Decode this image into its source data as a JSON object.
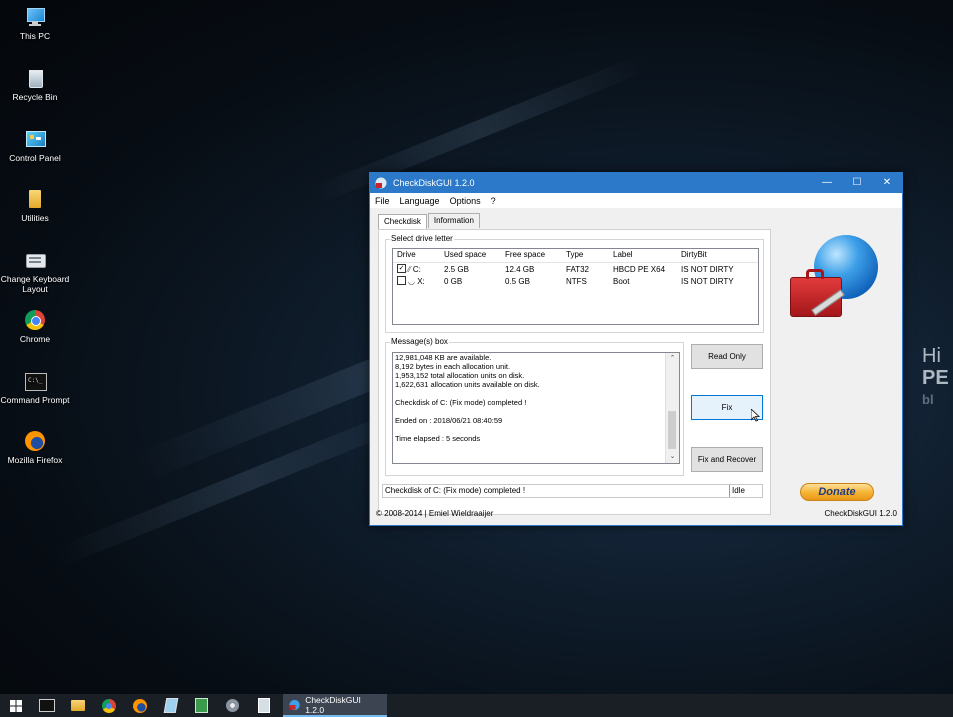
{
  "desktop": {
    "icons": [
      {
        "label": "This PC",
        "icon": "computer-icon"
      },
      {
        "label": "Recycle Bin",
        "icon": "recycle-bin-icon"
      },
      {
        "label": "Control Panel",
        "icon": "control-panel-icon"
      },
      {
        "label": "Utilities",
        "icon": "folder-icon"
      },
      {
        "label": "Change Keyboard Layout",
        "icon": "keyboard-icon"
      },
      {
        "label": "Chrome",
        "icon": "chrome-icon"
      },
      {
        "label": "Command Prompt",
        "icon": "command-prompt-icon"
      },
      {
        "label": "Mozilla Firefox",
        "icon": "firefox-icon"
      }
    ],
    "wallpaper_text": [
      "Hi",
      "PE",
      "bl"
    ]
  },
  "window": {
    "title": "CheckDiskGUI 1.2.0",
    "controls": {
      "minimize": "—",
      "maximize": "☐",
      "close": "✕"
    },
    "menu": [
      "File",
      "Language",
      "Options",
      "?"
    ],
    "tabs": [
      "Checkdisk",
      "Information"
    ],
    "drive_group": {
      "label": "Select drive letter",
      "columns": [
        "Drive",
        "Used space",
        "Free space",
        "Type",
        "Label",
        "DirtyBit"
      ],
      "rows": [
        {
          "checked": true,
          "drive": "C:",
          "used": "2.5 GB",
          "free": "12.4 GB",
          "type": "FAT32",
          "label": "HBCD PE X64",
          "dirty": "IS NOT DIRTY"
        },
        {
          "checked": false,
          "drive": "X:",
          "used": "0 GB",
          "free": "0.5 GB",
          "type": "NTFS",
          "label": "Boot",
          "dirty": "IS NOT DIRTY"
        }
      ]
    },
    "message_group": {
      "label": "Message(s) box",
      "lines": [
        "12,981,048 KB are available.",
        "  8,192 bytes in each allocation unit.",
        "  1,953,152 total allocation units on disk.",
        "  1,622,631 allocation units available on disk.",
        "",
        "Checkdisk of C: (Fix mode) completed !",
        "",
        "Ended on : 2018/06/21 08:40:59",
        "",
        "Time elapsed : 5 seconds"
      ]
    },
    "buttons": {
      "read_only": "Read Only",
      "fix": "Fix",
      "fix_recover": "Fix and Recover",
      "donate": "Donate"
    },
    "status": {
      "message": "Checkdisk of C: (Fix mode) completed !",
      "state": "Idle"
    },
    "footer": {
      "copyright": "© 2008-2014 | Emiel Wieldraaijer",
      "version": "CheckDiskGUI 1.2.0"
    }
  },
  "taskbar": {
    "items": [
      "start-icon",
      "command-prompt-icon",
      "file-explorer-icon",
      "chrome-icon",
      "firefox-icon",
      "notepad-icon",
      "spreadsheet-icon",
      "disk-tool-icon",
      "document-icon"
    ],
    "active_app": "CheckDiskGUI 1.2.0"
  },
  "colors": {
    "titlebar": "#2b79c8",
    "focus": "#0078d7",
    "taskbar": "#1a1f26",
    "donate": "#f5b230"
  }
}
